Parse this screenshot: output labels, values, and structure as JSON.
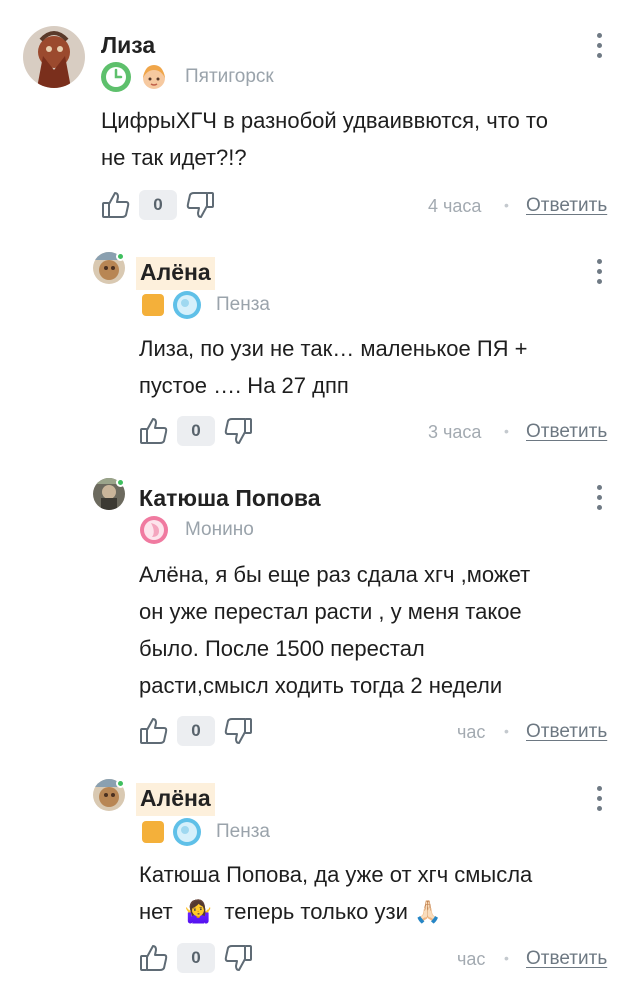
{
  "comments": [
    {
      "author": "Лиза",
      "city": "Пятигорск",
      "text_lines": [
        "ЦифрыХГЧ в разнобой удваиввются, что то",
        "не так идет?!?"
      ],
      "likes": "0",
      "time": "4 часа",
      "reply": "Ответить",
      "badges": [
        "clock-badge-icon",
        "girl-emoji-icon"
      ]
    },
    {
      "author": "Алёна",
      "city": "Пенза",
      "text_lines": [
        "Лиза, по узи не так… маленькое ПЯ +",
        "пустое …. На 27 дпп"
      ],
      "likes": "0",
      "time": "3 часа",
      "reply": "Ответить",
      "badges": [
        "orange-square-icon",
        "baby-circle-icon"
      ]
    },
    {
      "author": "Катюша Попова",
      "city": "Монино",
      "text_lines": [
        "Алёна, я бы еще раз сдала хгч ,может",
        "он уже перестал расти , у меня такое",
        "было. После 1500 перестал",
        "расти,смысл ходить тогда 2 недели"
      ],
      "likes": "0",
      "time": "час",
      "reply": "Ответить",
      "badges": [
        "pregnancy-circle-icon"
      ]
    },
    {
      "author": "Алёна",
      "city": "Пенза",
      "text_lines": [
        "Катюша Попова, да уже от хгч смысла",
        "нет",
        "теперь только узи"
      ],
      "emoji": [
        "🤷‍♀️",
        "🙏🏻"
      ],
      "likes": "0",
      "time": "час",
      "reply": "Ответить",
      "badges": [
        "orange-square-icon",
        "baby-circle-icon"
      ]
    }
  ],
  "colors": {
    "accent_highlight": "#fdf0dc",
    "online": "#3fbf5f",
    "muted": "#9aa3ab",
    "reply_link": "#6d7882"
  }
}
